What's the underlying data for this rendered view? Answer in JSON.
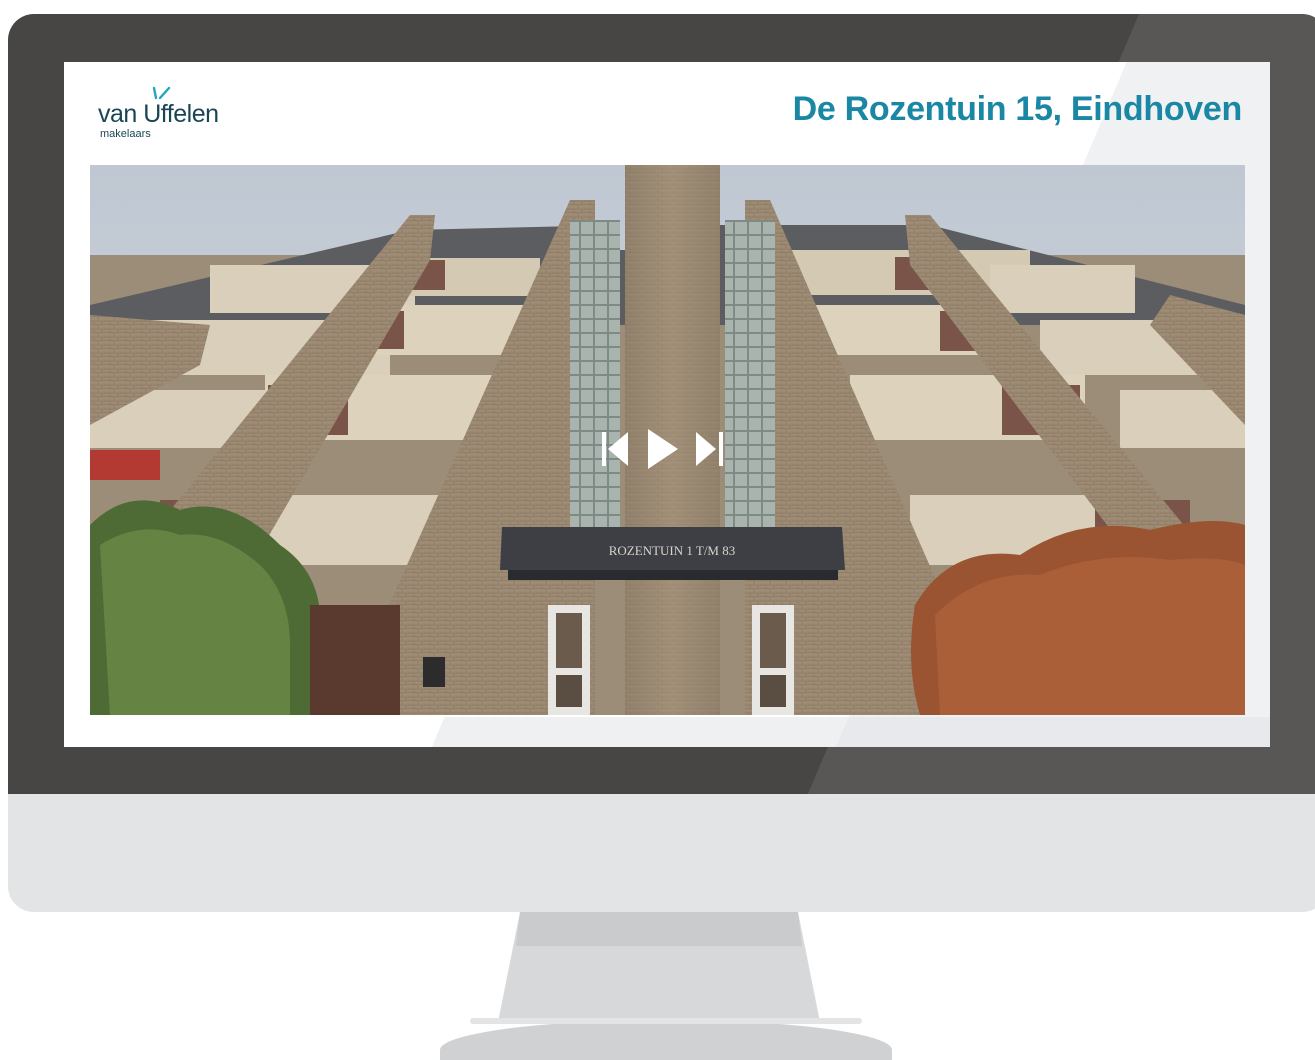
{
  "brand": {
    "name": "van Uffelen",
    "tagline": "makelaars",
    "color": "#1b4555",
    "accent": "#1a87a5"
  },
  "listing": {
    "title": "De Rozentuin 15, Eindhoven"
  },
  "photo": {
    "signage_text": "ROZENTUIN 1 T/M 83"
  },
  "player": {
    "controls": [
      {
        "icon": "skip-back-icon"
      },
      {
        "icon": "play-icon"
      },
      {
        "icon": "skip-forward-icon"
      }
    ]
  },
  "colors": {
    "bezel": "#474644",
    "chin": "#e3e4e6",
    "title": "#1a87a5"
  }
}
